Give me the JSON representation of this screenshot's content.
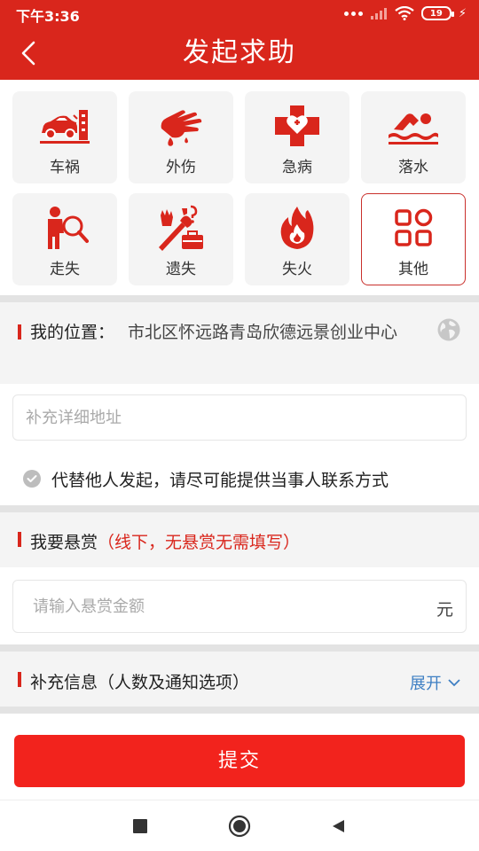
{
  "status_bar": {
    "time": "下午3:36",
    "battery": "19",
    "icons": [
      "more-dots-icon",
      "signal-icon",
      "wifi-icon",
      "battery-icon",
      "charging-bolt-icon"
    ]
  },
  "header": {
    "title": "发起求助",
    "back_icon": "chevron-left-icon"
  },
  "categories": [
    {
      "label": "车祸",
      "icon": "car-crash-icon"
    },
    {
      "label": "外伤",
      "icon": "injured-hand-icon"
    },
    {
      "label": "急病",
      "icon": "medical-cross-icon"
    },
    {
      "label": "落水",
      "icon": "swimmer-icon"
    },
    {
      "label": "走失",
      "icon": "lost-person-search-icon"
    },
    {
      "label": "遗失",
      "icon": "lost-items-icon"
    },
    {
      "label": "失火",
      "icon": "fire-icon"
    },
    {
      "label": "其他",
      "icon": "grid-other-icon",
      "selected": true
    }
  ],
  "location": {
    "label": "我的位置：",
    "value": "市北区怀远路青岛欣德远景创业中心",
    "icon": "globe-icon"
  },
  "address_input": {
    "placeholder": "补充详细地址",
    "value": ""
  },
  "proxy": {
    "text": "代替他人发起，请尽可能提供当事人联系方式",
    "checked": false
  },
  "reward": {
    "label": "我要悬赏",
    "note": "（线下，无悬赏无需填写）",
    "placeholder": "请输入悬赏金额",
    "value": "",
    "unit": "元"
  },
  "extra": {
    "label": "补充信息（人数及通知选项）",
    "expand_label": "展开"
  },
  "submit_label": "提交",
  "nav": {
    "icons": [
      "square-recent-icon",
      "circle-home-icon",
      "triangle-back-icon"
    ]
  },
  "colors": {
    "primary": "#d9261c",
    "submit": "#f2231d",
    "link": "#3e7fc3",
    "tile_bg": "#f4f4f4"
  }
}
